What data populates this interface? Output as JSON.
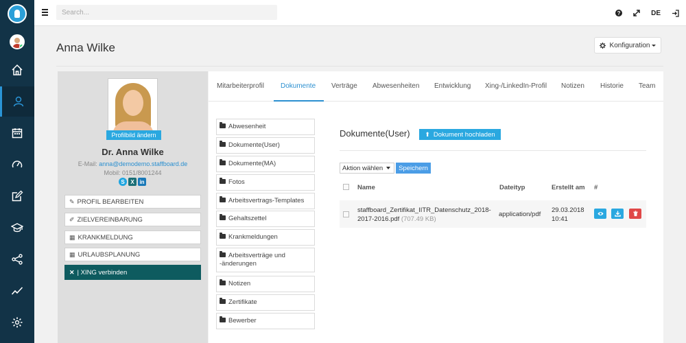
{
  "topbar": {
    "search_placeholder": "Search...",
    "help_icon": "?",
    "lang": "DE",
    "icons": [
      "menu-icon",
      "question-icon",
      "expand-icon",
      "logout-icon"
    ]
  },
  "rail": {
    "items": [
      "home-icon",
      "users-icon",
      "calendar-icon",
      "dashboard-icon",
      "edit-icon",
      "graduation-icon",
      "share-icon",
      "chart-icon",
      "settings-icon"
    ],
    "active_item": "users-icon"
  },
  "page": {
    "title": "Anna Wilke",
    "config_label": "Konfiguration"
  },
  "profile": {
    "change_photo": "Profilbild ändern",
    "name": "Dr. Anna Wilke",
    "email_label": "E-Mail:",
    "email": "anna@demodemo.staffboard.de",
    "mobile": "Mobil: 0151/8001244",
    "social": [
      "S",
      "X",
      "in"
    ],
    "buttons": [
      "PROFIL BEARBEITEN",
      "ZIELVEREINBARUNG",
      "KRANKMELDUNG",
      "URLAUBSPLANUNG"
    ],
    "xing_button": "| XING verbinden"
  },
  "tabs": {
    "items": [
      "Mitarbeiterprofil",
      "Dokumente",
      "Verträge",
      "Abwesenheiten",
      "Entwicklung",
      "Xing-/LinkedIn-Profil",
      "Notizen",
      "Historie",
      "Team"
    ],
    "active": "Dokumente"
  },
  "folders": [
    "Abwesenheit",
    "Dokumente(User)",
    "Dokumente(MA)",
    "Fotos",
    "Arbeitsvertrags-Templates",
    "Gehaltszettel",
    "Krankmeldungen",
    "Arbeitsverträge und -änderungen",
    "Notizen",
    "Zertifikate",
    "Bewerber"
  ],
  "documents": {
    "title": "Dokumente(User)",
    "upload_label": "Dokument hochladen",
    "action_label": "Aktion wählen",
    "save_label": "Speichern",
    "columns": [
      "Name",
      "Dateityp",
      "Erstellt am",
      "#"
    ],
    "rows": [
      {
        "name": "staffboard_Zertifikat_IITR_Datenschutz_2018-2017-2016.pdf",
        "size": "(707.49 KB)",
        "type": "application/pdf",
        "date": "29.03.2018",
        "time": "10:41"
      }
    ],
    "colors": {
      "view": "#2aa8e0",
      "download": "#2aa8e0",
      "delete": "#e04848"
    }
  }
}
